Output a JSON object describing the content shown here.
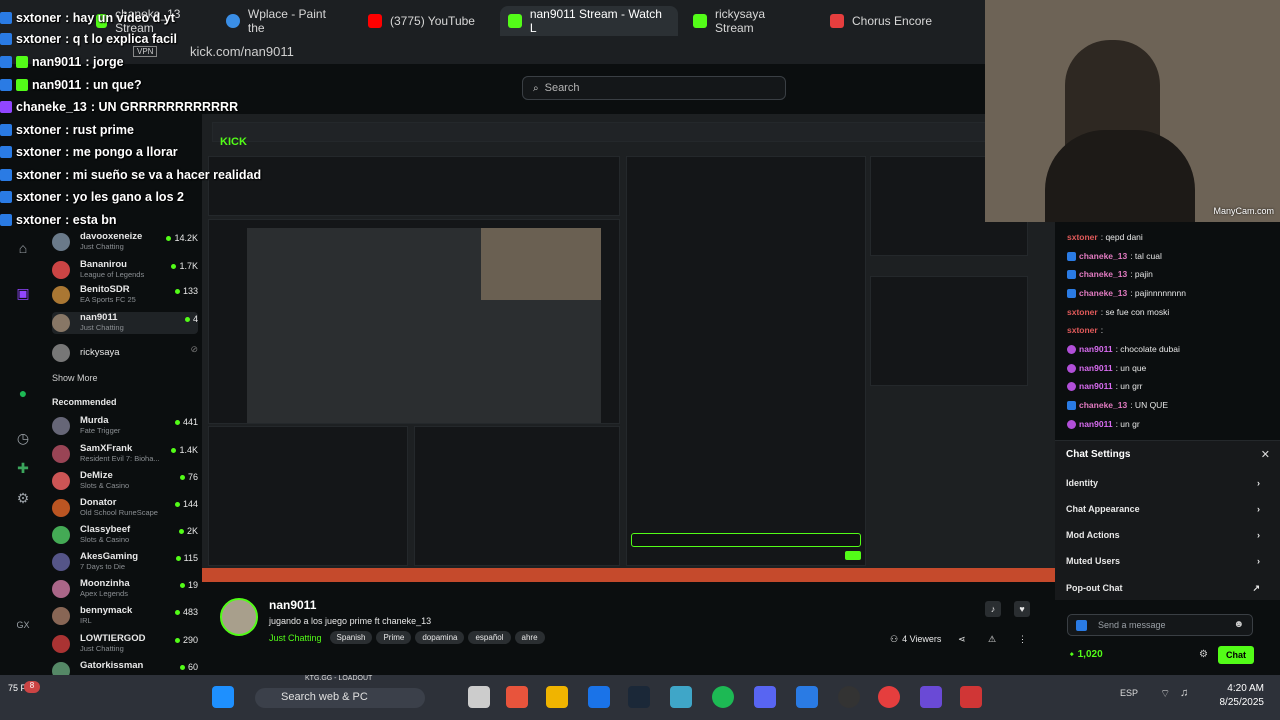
{
  "browser": {
    "tabs": [
      {
        "label": "chaneke_13 Stream",
        "active": false
      },
      {
        "label": "Wplace - Paint the",
        "active": false
      },
      {
        "label": "(3775) YouTube",
        "active": false
      },
      {
        "label": "nan9011 Stream - Watch L",
        "active": true
      },
      {
        "label": "rickysaya Stream",
        "active": false
      },
      {
        "label": "Chorus Encore",
        "active": false
      }
    ],
    "url": "kick.com/nan9011",
    "vpn_badge": "VPN"
  },
  "header": {
    "search_placeholder": "Search",
    "logo": "KICK"
  },
  "overlay_chat": [
    {
      "user": "sxtoner",
      "text": ": hay un video d yt",
      "green": false
    },
    {
      "user": "sxtoner",
      "text": ": q t lo explica facil",
      "green": false
    },
    {
      "user": "nan9011",
      "text": ": jorge",
      "green": false
    },
    {
      "user": "nan9011",
      "text": ": un que?",
      "green": false
    },
    {
      "user": "chaneke_13",
      "text": ": UN GRRRRRRRRRRRR",
      "green": false
    },
    {
      "user": "sxtoner",
      "text": ": rust prime",
      "green": false
    },
    {
      "user": "sxtoner",
      "text": ": me pongo a llorar",
      "green": false
    },
    {
      "user": "sxtoner",
      "text": ": mi sueño se va a hacer realidad",
      "green": false
    },
    {
      "user": "sxtoner",
      "text": ": yo les gano a los 2",
      "green": false
    },
    {
      "user": "sxtoner",
      "text": ": esta bn",
      "green": false
    }
  ],
  "sidebar": {
    "following": [
      {
        "name": "davooxeneize",
        "category": "Just Chatting",
        "viewers": "14.2K"
      },
      {
        "name": "Bananirou",
        "category": "League of Legends",
        "viewers": "1.7K"
      },
      {
        "name": "BenitoSDR",
        "category": "EA Sports FC 25",
        "viewers": "133"
      },
      {
        "name": "nan9011",
        "category": "Just Chatting",
        "viewers": "4"
      },
      {
        "name": "rickysaya",
        "category": "",
        "viewers": ""
      }
    ],
    "show_more": "Show More",
    "recommended_label": "Recommended",
    "recommended": [
      {
        "name": "Murda",
        "category": "Fate Trigger",
        "viewers": "441"
      },
      {
        "name": "SamXFrank",
        "category": "Resident Evil 7: Bioha...",
        "viewers": "1.4K"
      },
      {
        "name": "DeMize",
        "category": "Slots & Casino",
        "viewers": "76"
      },
      {
        "name": "Donator",
        "category": "Old School RuneScape",
        "viewers": "144"
      },
      {
        "name": "Classybeef",
        "category": "Slots & Casino",
        "viewers": "2K"
      },
      {
        "name": "AkesGaming",
        "category": "7 Days to Die",
        "viewers": "115"
      },
      {
        "name": "Moonzinha",
        "category": "Apex Legends",
        "viewers": "19"
      },
      {
        "name": "bennymack",
        "category": "IRL",
        "viewers": "483"
      },
      {
        "name": "LOWTIERGOD",
        "category": "Just Chatting",
        "viewers": "290"
      },
      {
        "name": "Gatorkissman",
        "category": "",
        "viewers": "60"
      }
    ]
  },
  "stream_info": {
    "channel": "nan9011",
    "title": "jugando a los juego prime ft chaneke_13",
    "category": "Just Chatting",
    "tags": [
      "Spanish",
      "Prime",
      "dopamina",
      "español",
      "ahre"
    ],
    "viewers": "4 Viewers"
  },
  "right_chat": [
    {
      "user": "sxtoner",
      "text": ": qepd dani",
      "badge": "blue"
    },
    {
      "user": "chaneke_13",
      "text": ": tal cual",
      "badge": "blue"
    },
    {
      "user": "chaneke_13",
      "text": ": pajin",
      "badge": "blue"
    },
    {
      "user": "chaneke_13",
      "text": ": pajinnnnnnnn",
      "badge": "blue"
    },
    {
      "user": "sxtoner",
      "text": ": se fue con moski",
      "badge": "none"
    },
    {
      "user": "sxtoner",
      "text": ": ",
      "badge": "none"
    },
    {
      "user": "nan9011",
      "text": ": chocolate dubai",
      "badge": "purple"
    },
    {
      "user": "nan9011",
      "text": ": un que",
      "badge": "purple"
    },
    {
      "user": "nan9011",
      "text": ": un grr",
      "badge": "purple"
    },
    {
      "user": "chaneke_13",
      "text": ": UN QUE",
      "badge": "blue"
    },
    {
      "user": "nan9011",
      "text": ": un gr",
      "badge": "purple"
    }
  ],
  "chat_settings": {
    "title": "Chat Settings",
    "items": [
      "Identity",
      "Chat Appearance",
      "Mod Actions",
      "Muted Users",
      "Pop-out Chat"
    ],
    "input_placeholder": "Send a message",
    "points": "1,020",
    "send_label": "Chat"
  },
  "webcam": {
    "watermark": "ManyCam.com"
  },
  "taskbar": {
    "overlay_label": "KTG.GG - LOADOUT",
    "search_placeholder": "Search web & PC",
    "time": "4:20 AM",
    "date": "8/25/2025",
    "fps": "75 FPS",
    "lang": "ESP"
  },
  "colors": {
    "kick_green": "#53fc18",
    "accent_blue": "#2a7be4",
    "purple": "#b14fd8"
  }
}
